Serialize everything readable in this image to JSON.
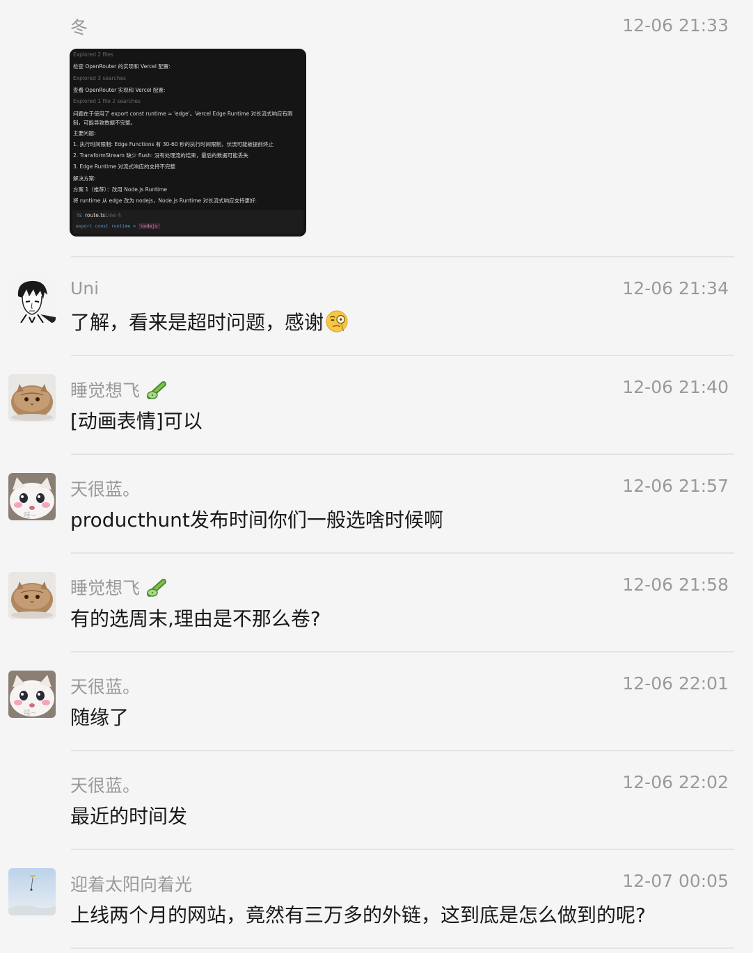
{
  "messages": [
    {
      "sender": "冬",
      "time": "12-06 21:33",
      "image": {
        "lines": [
          {
            "text": "Explored 2 files",
            "dim": true
          },
          {
            "text": "检查 OpenRouter 的实现和 Vercel 配置:",
            "dim": false
          },
          {
            "text": "Explored 3 searches",
            "dim": true
          },
          {
            "text": "查看 OpenRouter 实现和 Vercel 配置:",
            "dim": false
          },
          {
            "text": "Explored 1 file 2 searches",
            "dim": true
          },
          {
            "text": "问题在于使用了 export const runtime = 'edge'。Vercel Edge Runtime 对长流式响应有限",
            "dim": false
          },
          {
            "text": "制，可能导致数据不完整。",
            "dim": false
          },
          {
            "text": "主要问题:",
            "dim": false
          },
          {
            "text": "1. 执行时间限制: Edge Functions 有 30-60 秒的执行时间限制，长流可能被提前终止",
            "dim": false
          },
          {
            "text": "2. TransformStream 缺少 flush: 没有处理流的结束，最后的数据可能丢失",
            "dim": false
          },
          {
            "text": "3. Edge Runtime 对流式响应的支持不完整",
            "dim": false
          },
          {
            "text": "解决方案:",
            "dim": false
          },
          {
            "text": "方案 1（推荐）：改用 Node.js Runtime",
            "dim": false
          },
          {
            "text": "将 runtime 从 edge 改为 nodejs，Node.js Runtime 对长流式响应支持更好:",
            "dim": false
          }
        ],
        "code_file": "route.ts",
        "code_file_badge": "TS",
        "code_line": "Line 4",
        "code_prefix": "export const runtime = ",
        "code_value": "'nodejs'"
      }
    },
    {
      "sender": "Uni",
      "time": "12-06 21:34",
      "text": "了解，看来是超时问题，感谢"
    },
    {
      "sender": "睡觉想飞",
      "time": "12-06 21:40",
      "text": "[动画表情]可以"
    },
    {
      "sender": "天很蓝。",
      "time": "12-06 21:57",
      "text": "producthunt发布时间你们一般选啥时候啊"
    },
    {
      "sender": "睡觉想飞",
      "time": "12-06 21:58",
      "text": "有的选周末,理由是不那么卷?"
    },
    {
      "sender": "天很蓝。",
      "time": "12-06 22:01",
      "text": "随缘了"
    },
    {
      "sender": "天很蓝。",
      "time": "12-06 22:02",
      "text": "最近的时间发"
    },
    {
      "sender": "迎着太阳向着光",
      "time": "12-07 00:05",
      "text": "上线两个月的网站，竟然有三万多的外链，这到底是怎么做到的呢?"
    }
  ],
  "avatars": {
    "uni": "anime-sketch-avatar",
    "shuijiao": "cat-loaf-avatar",
    "tianhenlan": "white-cat-avatar",
    "tianhenlan_caption": "哇~",
    "yingzhe": "sky-kite-avatar"
  },
  "icons": {
    "cucumber": "cucumber-emoji-icon",
    "monocle": "monocle-face-emoji-icon"
  },
  "colors": {
    "background": "#f5f5f5",
    "text": "#191919",
    "meta": "#999999",
    "divider": "#e4e4e4"
  }
}
